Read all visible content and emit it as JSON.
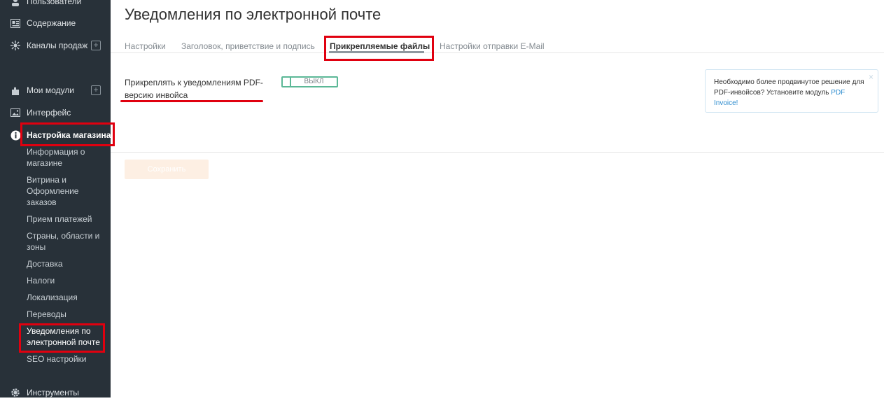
{
  "sidebar": {
    "top_items": [
      {
        "label": "Пользователи",
        "icon": "users-icon"
      },
      {
        "label": "Содержание",
        "icon": "content-icon"
      },
      {
        "label": "Каналы продаж",
        "icon": "sales-channels-icon"
      },
      {
        "label": "Мои модули",
        "icon": "modules-icon"
      },
      {
        "label": "Интерфейс",
        "icon": "image-icon"
      },
      {
        "label": "Настройка магазина",
        "icon": "info-icon"
      },
      {
        "label": "Инструменты",
        "icon": "gear-icon"
      }
    ],
    "sub_items": [
      "Информация о магазине",
      "Витрина и Оформление заказов",
      "Прием платежей",
      "Страны, области и зоны",
      "Доставка",
      "Налоги",
      "Локализация",
      "Переводы",
      "Уведомления по электронной почте",
      "SEO настройки"
    ]
  },
  "page": {
    "title": "Уведомления по электронной почте"
  },
  "tabs": [
    {
      "label": "Настройки"
    },
    {
      "label": "Заголовок, приветствие и подпись"
    },
    {
      "label": "Прикрепляемые файлы"
    },
    {
      "label": "Настройки отправки E-Mail"
    }
  ],
  "form": {
    "attach_pdf_label": "Прикреплять к уведомлениям PDF-версию инвойса",
    "toggle_state": "ВЫКЛ"
  },
  "infobox": {
    "text": "Необходимо более продвинутое решение для PDF-инвойсов? Установите модуль",
    "link": "PDF Invoice!",
    "close": "×"
  },
  "save_button": "Сохранить",
  "colors": {
    "sidebar_bg": "#283139",
    "highlight_red": "#e0000f",
    "toggle_green": "#5cb897",
    "link_blue": "#2f8dcf"
  }
}
